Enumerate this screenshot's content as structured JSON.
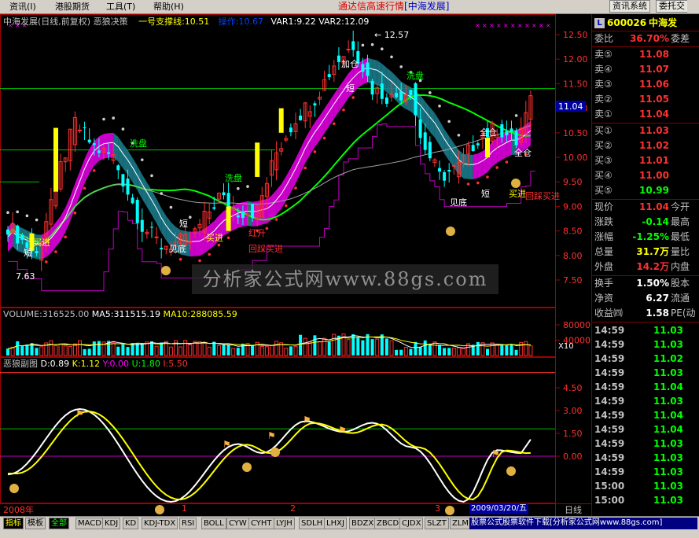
{
  "menu": {
    "items": [
      "资讯(I)",
      "港股期货",
      "工具(T)",
      "帮助(H)"
    ],
    "title_prefix": "通达信高速行情",
    "title_suffix": "[中海发展]",
    "right_buttons": [
      "资讯系统",
      "委托交"
    ]
  },
  "main_pane": {
    "stock_label": "中海发展(日线,前复权)",
    "indicator_name": "恶狼决策",
    "support_line": "一号支撑线:10.51",
    "control_line": "操作:10.67",
    "var1": "VAR1:9.22",
    "var2": "VAR2:12.09",
    "y_ticks": [
      "12.50",
      "12.00",
      "11.50",
      "11.00",
      "10.50",
      "10.00",
      "9.50",
      "9.00",
      "8.50",
      "8.00",
      "7.50"
    ],
    "y_values": [
      12.5,
      12.0,
      11.5,
      11.0,
      10.5,
      10.0,
      9.5,
      9.0,
      8.5,
      8.0,
      7.5
    ],
    "current_price_tag": "11.04",
    "high_label": "12.57",
    "low_label": "7.63",
    "annotations": [
      {
        "text": "洗盘",
        "color": "#00ff00"
      },
      {
        "text": "洗盘",
        "color": "#00ff00"
      },
      {
        "text": "洗盘",
        "color": "#00ff00"
      },
      {
        "text": "买进",
        "color": "#ffff00"
      },
      {
        "text": "买进",
        "color": "#ffff00"
      },
      {
        "text": "买进",
        "color": "#ffff00"
      },
      {
        "text": "短",
        "color": "#ffffff"
      },
      {
        "text": "短",
        "color": "#ffffff"
      },
      {
        "text": "短",
        "color": "#ffffff"
      },
      {
        "text": "短",
        "color": "#ffffff"
      },
      {
        "text": "见底",
        "color": "#ffffff"
      },
      {
        "text": "见底",
        "color": "#ffffff"
      },
      {
        "text": "回踩买进",
        "color": "#ff3030"
      },
      {
        "text": "回踩买进",
        "color": "#ff3030"
      },
      {
        "text": "红升",
        "color": "#ff3030"
      },
      {
        "text": "全仓",
        "color": "#ffffff"
      },
      {
        "text": "全仓",
        "color": "#ffffff"
      },
      {
        "text": "加仓",
        "color": "#ffffff"
      }
    ]
  },
  "volume_pane": {
    "volume": "VOLUME:316525.00",
    "ma5": "MA5:311515.19",
    "ma10": "MA10:288085.59",
    "y_ticks": [
      "80000",
      "40000"
    ],
    "unit": "X10"
  },
  "sub_pane": {
    "name": "恶狼副图",
    "d": "D:0.89",
    "k": "K:1.12",
    "y": "Y:0.00",
    "u": "U:1.80",
    "i": "I:5.50",
    "y_ticks": [
      "4.50",
      "3.00",
      "1.50",
      "0.00"
    ],
    "y_values": [
      4.5,
      3.0,
      1.5,
      0.0
    ]
  },
  "x_axis": {
    "labels": [
      "2008年",
      "1",
      "2",
      "3"
    ],
    "date_tag": "2009/03/20/五",
    "period": "日线"
  },
  "quote": {
    "code": "600026",
    "name": "中海发",
    "rows_top": [
      {
        "label": "委比",
        "value": "36.70%",
        "color": "#ff3030",
        "label2": "委差"
      }
    ],
    "asks": [
      {
        "label": "卖⑤",
        "price": "11.08",
        "color": "#ff3030"
      },
      {
        "label": "卖④",
        "price": "11.07",
        "color": "#ff3030"
      },
      {
        "label": "卖③",
        "price": "11.06",
        "color": "#ff3030"
      },
      {
        "label": "卖②",
        "price": "11.05",
        "color": "#ff3030"
      },
      {
        "label": "卖①",
        "price": "11.04",
        "color": "#ff3030"
      }
    ],
    "bids": [
      {
        "label": "买①",
        "price": "11.03",
        "color": "#ff3030"
      },
      {
        "label": "买②",
        "price": "11.02",
        "color": "#ff3030"
      },
      {
        "label": "买③",
        "price": "11.01",
        "color": "#ff3030"
      },
      {
        "label": "买④",
        "price": "11.00",
        "color": "#ff3030"
      },
      {
        "label": "买⑤",
        "price": "10.99",
        "color": "#00ff00"
      }
    ],
    "stats": [
      {
        "label": "现价",
        "value": "11.04",
        "color": "#ff3030",
        "label2": "今开"
      },
      {
        "label": "涨跌",
        "value": "-0.14",
        "color": "#00ff00",
        "label2": "最高"
      },
      {
        "label": "涨幅",
        "value": "-1.25%",
        "color": "#00ff00",
        "label2": "最低"
      },
      {
        "label": "总量",
        "value": "31.7万",
        "color": "#ffff00",
        "label2": "量比"
      },
      {
        "label": "外盘",
        "value": "14.2万",
        "color": "#ff3030",
        "label2": "内盘"
      }
    ],
    "fin": [
      {
        "label": "换手",
        "value": "1.50%",
        "color": "#ffffff",
        "label2": "股本"
      },
      {
        "label": "净资",
        "value": "6.27",
        "color": "#ffffff",
        "label2": "流通"
      },
      {
        "label": "收益㈣",
        "value": "1.58",
        "color": "#ffffff",
        "label2": "PE(动"
      }
    ],
    "ticks": [
      {
        "time": "14:59",
        "price": "11.03"
      },
      {
        "time": "14:59",
        "price": "11.03"
      },
      {
        "time": "14:59",
        "price": "11.02"
      },
      {
        "time": "14:59",
        "price": "11.03"
      },
      {
        "time": "14:59",
        "price": "11.04"
      },
      {
        "time": "14:59",
        "price": "11.03"
      },
      {
        "time": "14:59",
        "price": "11.04"
      },
      {
        "time": "14:59",
        "price": "11.04"
      },
      {
        "time": "14:59",
        "price": "11.03"
      },
      {
        "time": "14:59",
        "price": "11.03"
      },
      {
        "time": "14:59",
        "price": "11.03"
      },
      {
        "time": "15:00",
        "price": "11.03"
      },
      {
        "time": "15:00",
        "price": "11.03"
      }
    ]
  },
  "tabs": [
    "指标",
    "模板",
    "全部",
    "MACD",
    "KDJ",
    "KD",
    "KDJ-TDX",
    "RSI",
    "BOLL",
    "CYW",
    "CYHT",
    "LYJH",
    "SDLH",
    "LHXJ",
    "BDZX",
    "ZBCD",
    "CJDX",
    "SLZT",
    "ZLMM"
  ],
  "ad_text": "股票公式股票软件下载[分析家公式网www.88gs.com]",
  "watermark": "分析家公式网www.88gs.com",
  "colors": {
    "up": "#ff3030",
    "down": "#00ffff",
    "ma_green": "#00ff00",
    "ma_white": "#ffffff",
    "magenta": "#ff00ff",
    "yellow": "#ffff00"
  }
}
